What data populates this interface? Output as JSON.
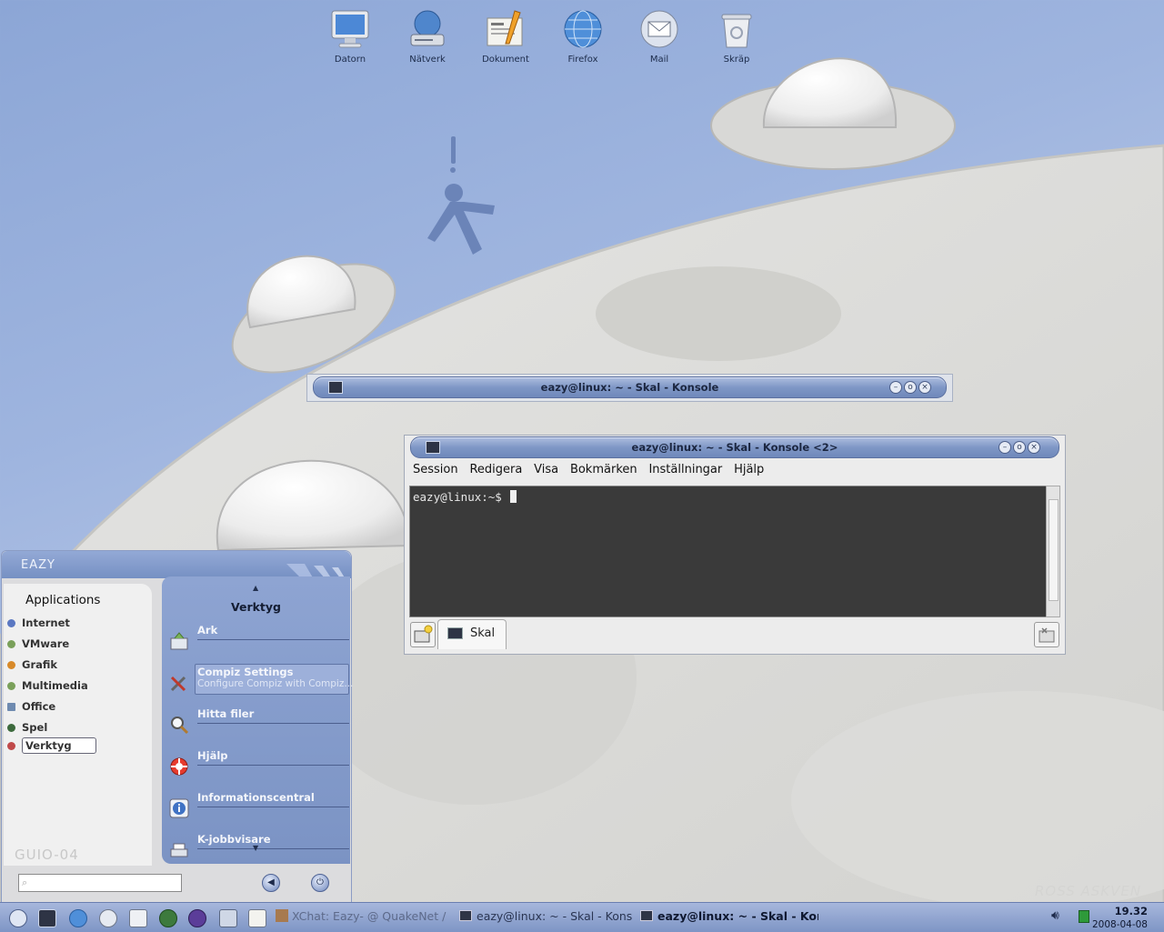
{
  "desktop": {
    "icons": [
      {
        "label": "Datorn",
        "icon": "computer-icon"
      },
      {
        "label": "Nätverk",
        "icon": "network-drive-icon"
      },
      {
        "label": "Dokument",
        "icon": "documents-icon"
      },
      {
        "label": "Firefox",
        "icon": "firefox-globe-icon"
      },
      {
        "label": "Mail",
        "icon": "mail-icon"
      },
      {
        "label": "Skräp",
        "icon": "trash-icon"
      }
    ]
  },
  "konsole1": {
    "title": "eazy@linux: ~ - Skal - Konsole"
  },
  "konsole2": {
    "title": "eazy@linux: ~ - Skal - Konsole <2>",
    "menu": [
      "Session",
      "Redigera",
      "Visa",
      "Bokmärken",
      "Inställningar",
      "Hjälp"
    ],
    "prompt": "eazy@linux:~$",
    "tab_label": "Skal"
  },
  "startmenu": {
    "brand": "EAZY",
    "heading": "Applications",
    "categories": [
      {
        "label": "Internet",
        "color": "#5b78c2"
      },
      {
        "label": "VMware",
        "color": "#7aa05a"
      },
      {
        "label": "Grafik",
        "color": "#d88a2a"
      },
      {
        "label": "Multimedia",
        "color": "#7aa05a"
      },
      {
        "label": "Office",
        "color": "#6f8bb0"
      },
      {
        "label": "Spel",
        "color": "#3d6a3d"
      },
      {
        "label": "Verktyg",
        "color": "#c04a4a"
      }
    ],
    "selected_category": "Verktyg",
    "section_title": "Verktyg",
    "items": [
      {
        "name": "Ark",
        "desc": ""
      },
      {
        "name": "Compiz Settings",
        "desc": "Configure Compiz with Compiz..."
      },
      {
        "name": "Hitta filer",
        "desc": ""
      },
      {
        "name": "Hjälp",
        "desc": ""
      },
      {
        "name": "Informationscentral",
        "desc": ""
      },
      {
        "name": "K-jobbvisare",
        "desc": ""
      }
    ],
    "watermark": "GUIO-04"
  },
  "taskbar": {
    "tasks": [
      {
        "label": "XChat: Eazy- @ QuakeNet /"
      },
      {
        "label": "eazy@linux: ~ - Skal - Kons"
      },
      {
        "label": "eazy@linux: ~ - Skal - Kor"
      }
    ],
    "clock_time": "19.32",
    "clock_date": "2008-04-08",
    "signature": "ROSS ASKVEN"
  }
}
